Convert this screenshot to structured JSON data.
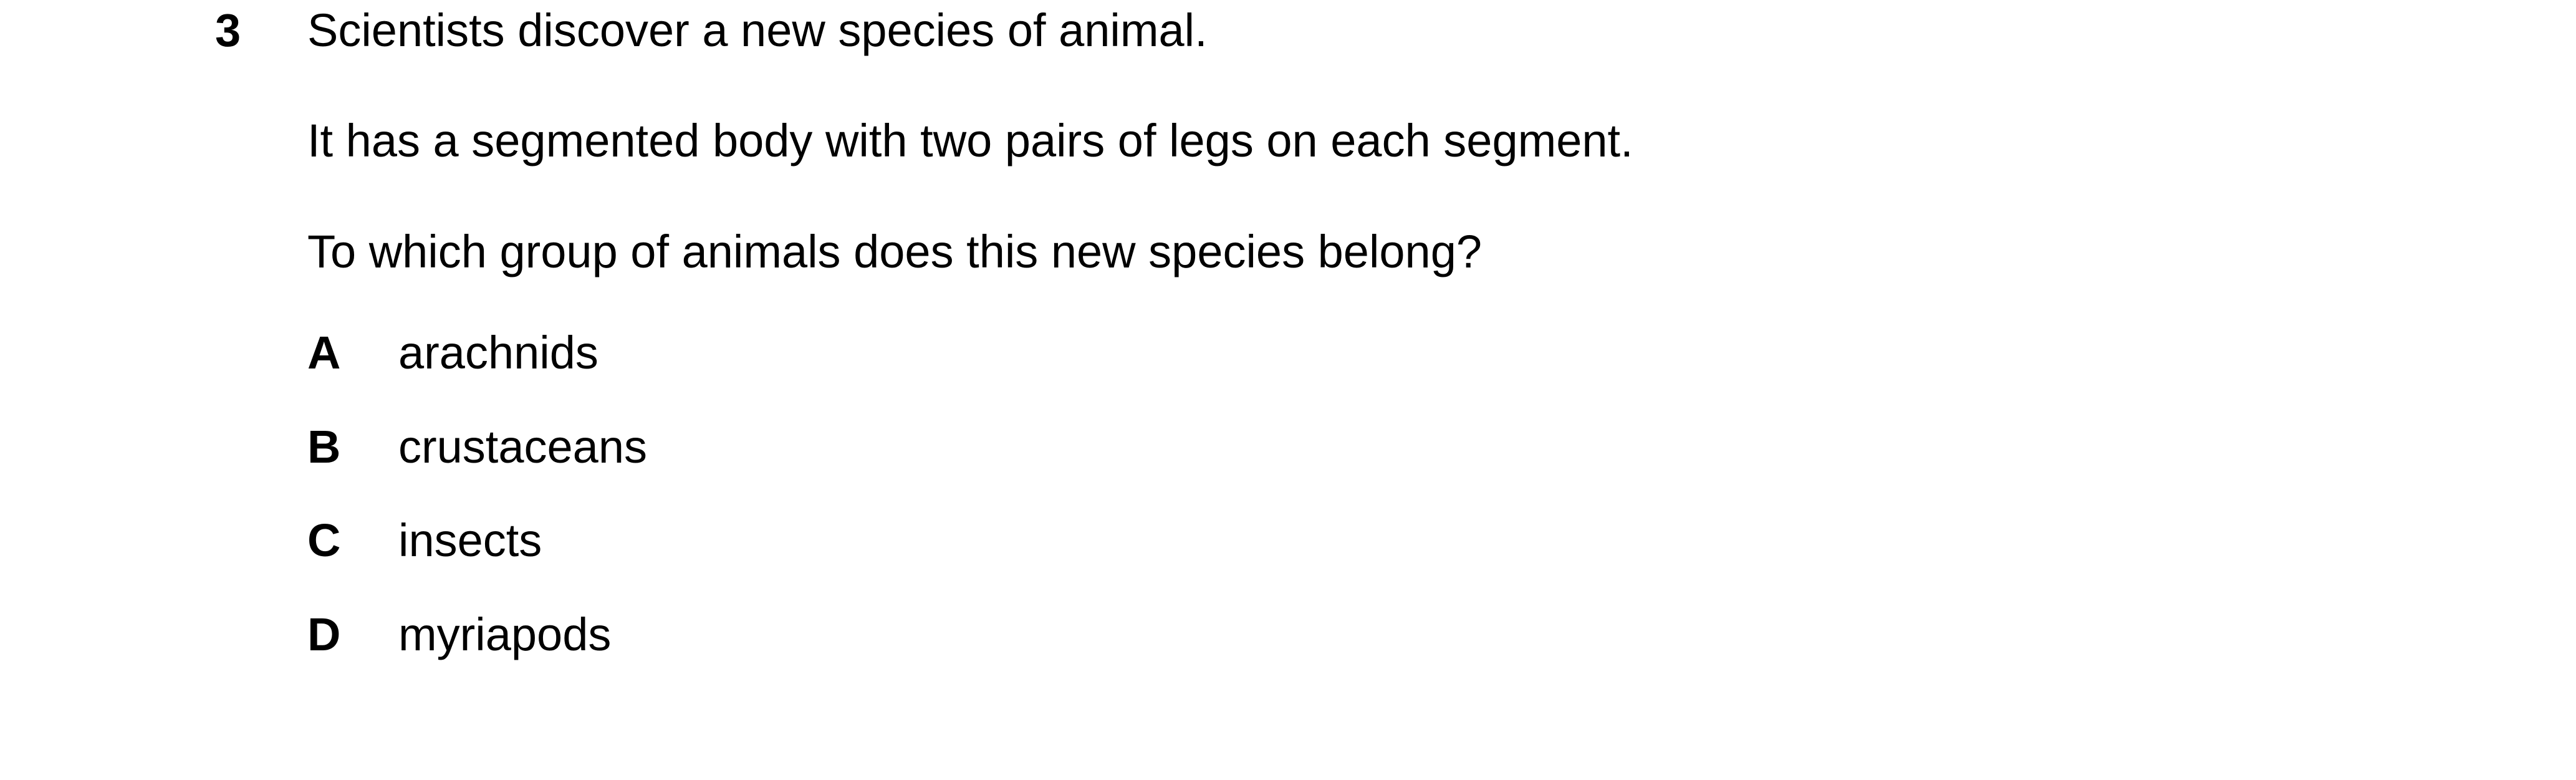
{
  "question": {
    "number": "3",
    "stem": [
      "Scientists discover a new species of animal.",
      "It has a segmented body with two pairs of legs on each segment.",
      "To which group of animals does this new species belong?"
    ],
    "options": [
      {
        "letter": "A",
        "text": "arachnids"
      },
      {
        "letter": "B",
        "text": "crustaceans"
      },
      {
        "letter": "C",
        "text": "insects"
      },
      {
        "letter": "D",
        "text": "myriapods"
      }
    ]
  }
}
